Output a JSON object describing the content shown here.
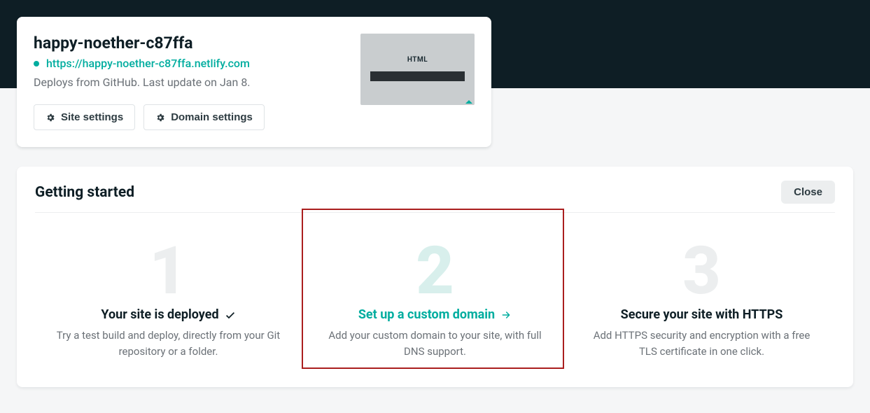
{
  "site": {
    "name": "happy-noether-c87ffa",
    "url": "https://happy-noether-c87ffa.netlify.com",
    "deploy_line": "Deploys from GitHub. Last update on Jan 8.",
    "thumb_label": "HTML",
    "buttons": {
      "site_settings": "Site settings",
      "domain_settings": "Domain settings"
    }
  },
  "getting_started": {
    "heading": "Getting started",
    "close_label": "Close",
    "steps": [
      {
        "num": "1",
        "title": "Your site is deployed",
        "desc": "Try a test build and deploy, directly from your Git repository or a folder."
      },
      {
        "num": "2",
        "title": "Set up a custom domain",
        "desc": "Add your custom domain to your site, with full DNS support."
      },
      {
        "num": "3",
        "title": "Secure your site with HTTPS",
        "desc": "Add HTTPS security and encryption with a free TLS certificate in one click."
      }
    ]
  }
}
